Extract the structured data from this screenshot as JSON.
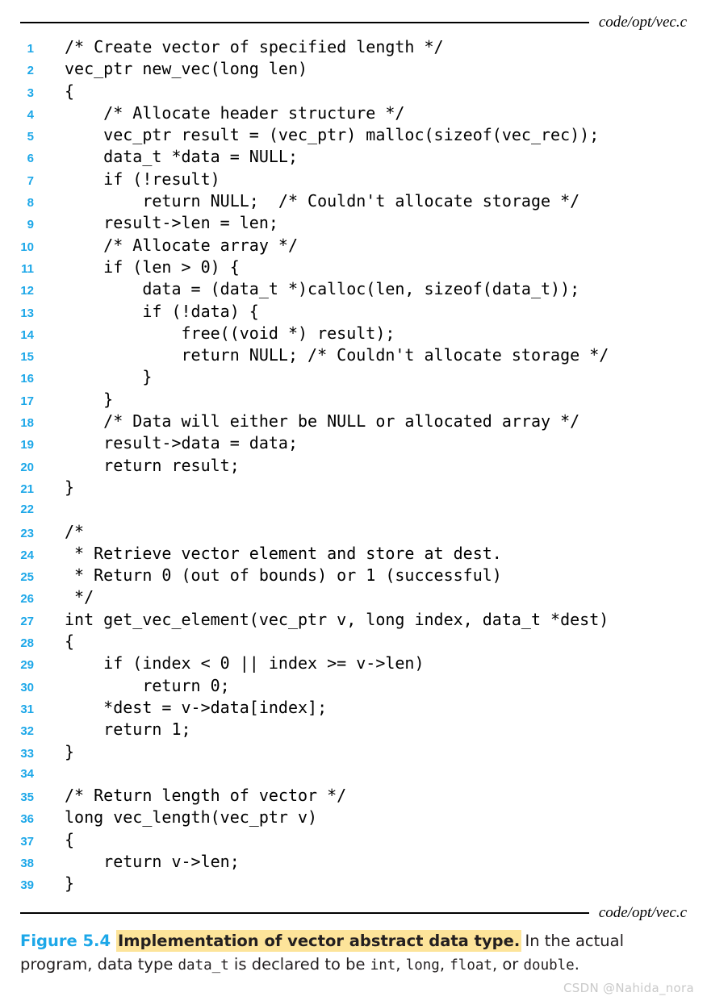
{
  "figure": {
    "source_label_top": "code/opt/vec.c",
    "source_label_bottom": "code/opt/vec.c",
    "accent_color": "#1CA7E8",
    "highlight_color": "#FDE49A",
    "rule_color": "#000000"
  },
  "caption": {
    "number": "Figure 5.4",
    "title": "Implementation of vector abstract data type.",
    "rest_1": " In the actual program, data type ",
    "mono_1": "data_t",
    "rest_2": " is declared to be ",
    "mono_2": "int",
    "rest_3": ", ",
    "mono_3": "long",
    "rest_4": ", ",
    "mono_4": "float",
    "rest_5": ", or ",
    "mono_5": "double",
    "rest_6": "."
  },
  "watermark": {
    "text": "CSDN @Nahida_nora"
  },
  "code": {
    "language": "c",
    "lines": [
      {
        "n": "1",
        "text": "/* Create vector of specified length */"
      },
      {
        "n": "2",
        "text": "vec_ptr new_vec(long len)"
      },
      {
        "n": "3",
        "text": "{"
      },
      {
        "n": "4",
        "text": "    /* Allocate header structure */"
      },
      {
        "n": "5",
        "text": "    vec_ptr result = (vec_ptr) malloc(sizeof(vec_rec));"
      },
      {
        "n": "6",
        "text": "    data_t *data = NULL;"
      },
      {
        "n": "7",
        "text": "    if (!result)"
      },
      {
        "n": "8",
        "text": "        return NULL;  /* Couldn't allocate storage */"
      },
      {
        "n": "9",
        "text": "    result->len = len;"
      },
      {
        "n": "10",
        "text": "    /* Allocate array */"
      },
      {
        "n": "11",
        "text": "    if (len > 0) {"
      },
      {
        "n": "12",
        "text": "        data = (data_t *)calloc(len, sizeof(data_t));"
      },
      {
        "n": "13",
        "text": "        if (!data) {"
      },
      {
        "n": "14",
        "text": "            free((void *) result);"
      },
      {
        "n": "15",
        "text": "            return NULL; /* Couldn't allocate storage */"
      },
      {
        "n": "16",
        "text": "        }"
      },
      {
        "n": "17",
        "text": "    }"
      },
      {
        "n": "18",
        "text": "    /* Data will either be NULL or allocated array */"
      },
      {
        "n": "19",
        "text": "    result->data = data;"
      },
      {
        "n": "20",
        "text": "    return result;"
      },
      {
        "n": "21",
        "text": "}"
      },
      {
        "n": "22",
        "text": ""
      },
      {
        "n": "23",
        "text": "/*"
      },
      {
        "n": "24",
        "text": " * Retrieve vector element and store at dest."
      },
      {
        "n": "25",
        "text": " * Return 0 (out of bounds) or 1 (successful)"
      },
      {
        "n": "26",
        "text": " */"
      },
      {
        "n": "27",
        "text": "int get_vec_element(vec_ptr v, long index, data_t *dest)"
      },
      {
        "n": "28",
        "text": "{"
      },
      {
        "n": "29",
        "text": "    if (index < 0 || index >= v->len)"
      },
      {
        "n": "30",
        "text": "        return 0;"
      },
      {
        "n": "31",
        "text": "    *dest = v->data[index];"
      },
      {
        "n": "32",
        "text": "    return 1;"
      },
      {
        "n": "33",
        "text": "}"
      },
      {
        "n": "34",
        "text": ""
      },
      {
        "n": "35",
        "text": "/* Return length of vector */"
      },
      {
        "n": "36",
        "text": "long vec_length(vec_ptr v)"
      },
      {
        "n": "37",
        "text": "{"
      },
      {
        "n": "38",
        "text": "    return v->len;"
      },
      {
        "n": "39",
        "text": "}"
      }
    ]
  }
}
